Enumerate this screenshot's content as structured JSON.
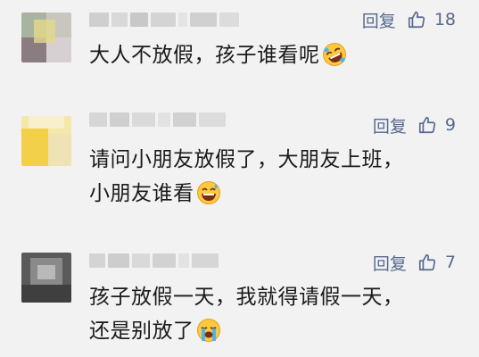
{
  "comments": [
    {
      "reply_label": "回复",
      "likes": "18",
      "text": "大人不放假，孩子谁看呢",
      "emoji": "rolling-laughing"
    },
    {
      "reply_label": "回复",
      "likes": "9",
      "text_line1": "请问小朋友放假了，大朋友上班，",
      "text_line2": "小朋友谁看",
      "emoji": "grinning-sweat"
    },
    {
      "reply_label": "回复",
      "likes": "7",
      "text_line1": "孩子放假一天，我就得请假一天，",
      "text_line2": "还是别放了",
      "emoji": "loudly-crying"
    }
  ],
  "colors": {
    "background": "#f2f2f2",
    "action": "#56698f",
    "text": "#1a1a1a"
  }
}
